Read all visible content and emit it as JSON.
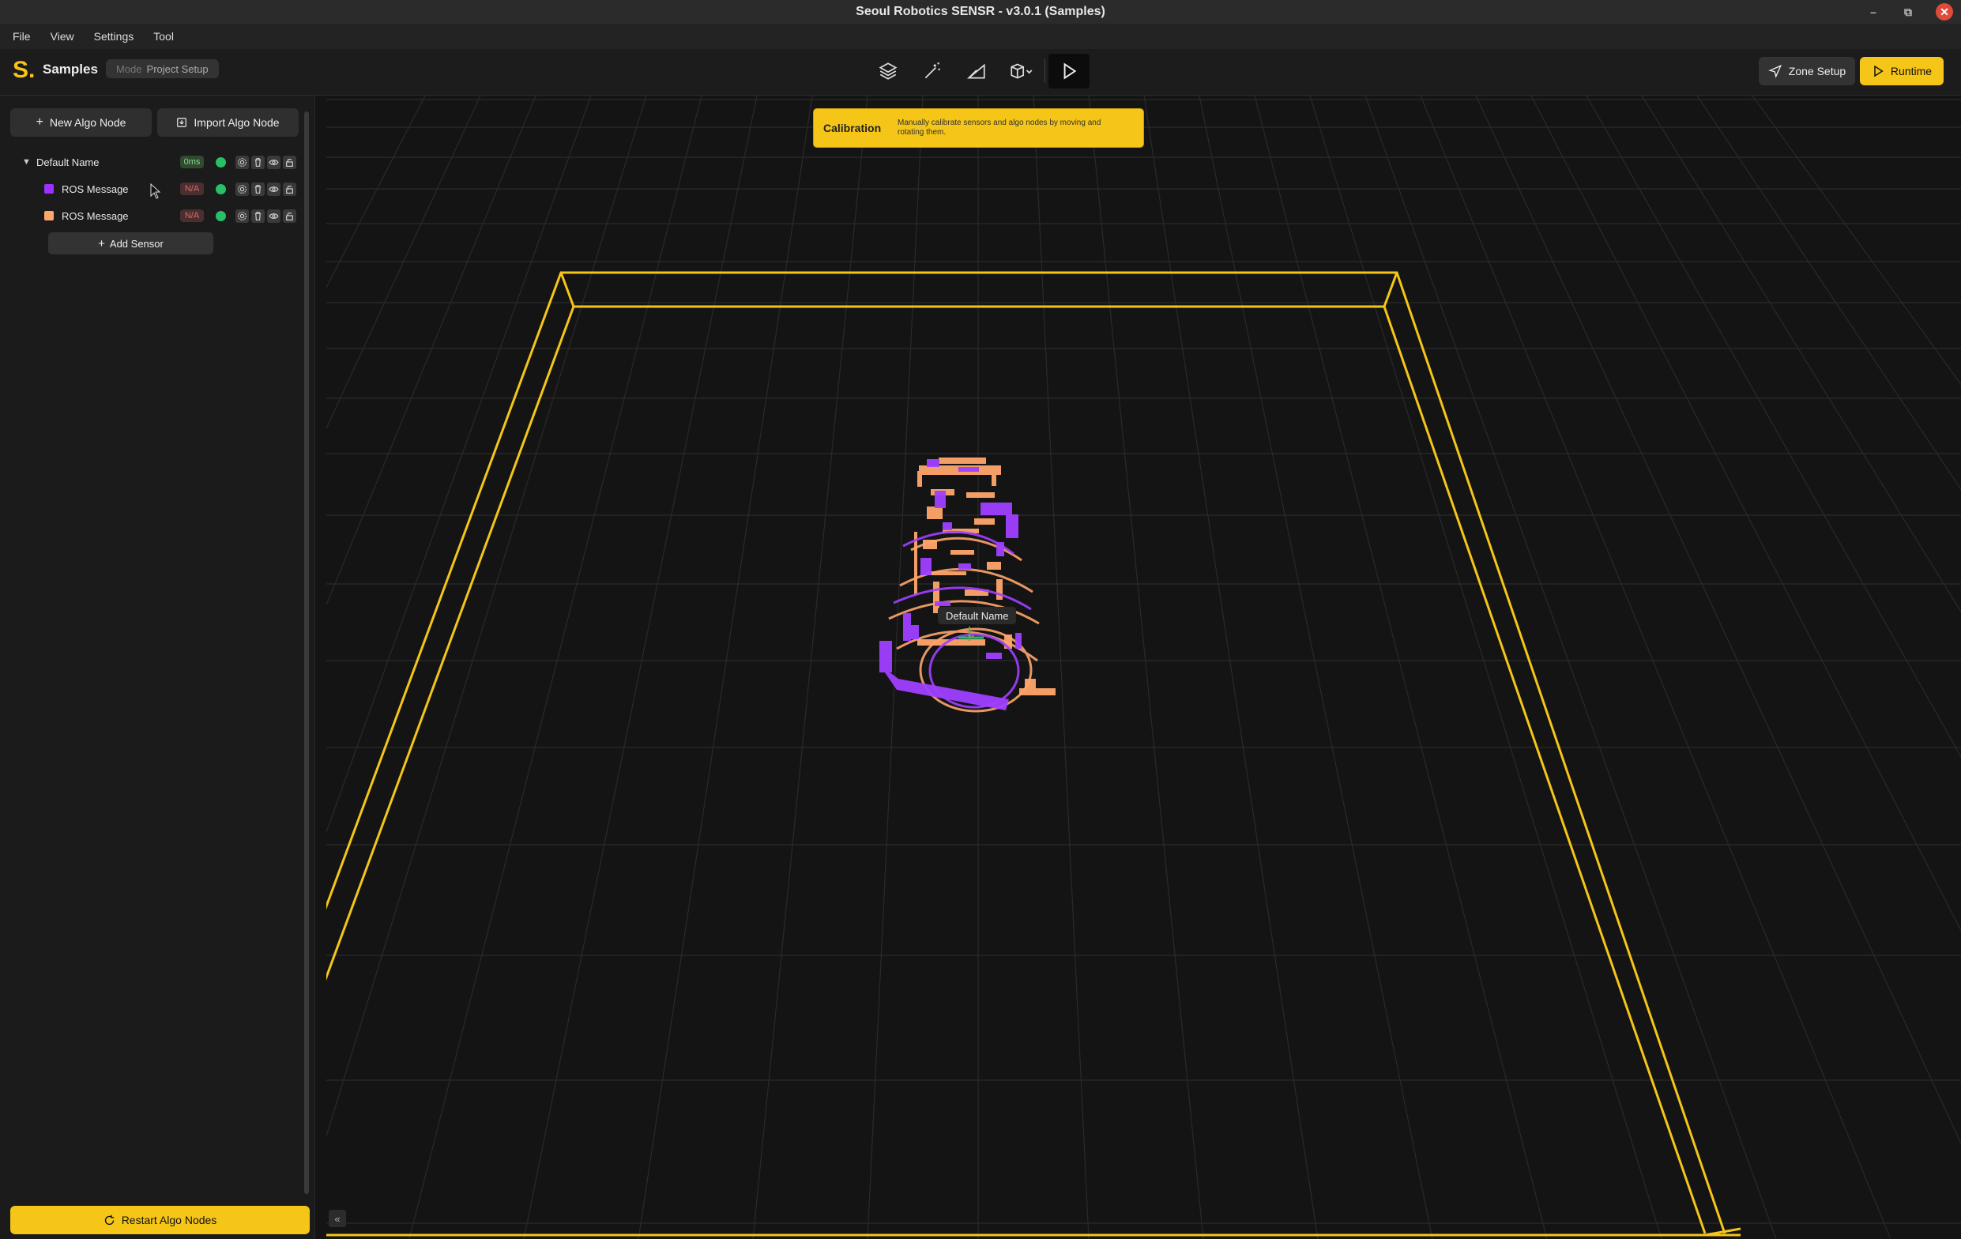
{
  "window": {
    "title": "Seoul Robotics SENSR - v3.0.1 (Samples)",
    "minimize_icon": "minimize-icon",
    "maximize_icon": "maximize-icon",
    "close_icon": "close-icon"
  },
  "menu": {
    "items": [
      "File",
      "View",
      "Settings",
      "Tool"
    ]
  },
  "appbar": {
    "logo": "S.",
    "project_name": "Samples",
    "mode_key": "Mode",
    "mode_value": "Project Setup",
    "tools": [
      "layers-icon",
      "magic-wand-icon",
      "ramp-icon",
      "cube-dropdown-icon",
      "play-icon"
    ],
    "zone_setup_label": "Zone Setup",
    "runtime_label": "Runtime"
  },
  "sidebar": {
    "new_algo_label": "New Algo Node",
    "import_algo_label": "Import Algo Node",
    "tree": [
      {
        "label": "Default Name",
        "latency": "0ms",
        "latency_state": "ok",
        "expanded": true
      },
      {
        "label": "ROS Message",
        "latency": "N/A",
        "latency_state": "na",
        "color": "#9b30ff"
      },
      {
        "label": "ROS Message",
        "latency": "N/A",
        "latency_state": "na",
        "color": "#ffa66b"
      }
    ],
    "add_sensor_label": "Add Sensor",
    "restart_label": "Restart Algo Nodes"
  },
  "viewport": {
    "banner_title": "Calibration",
    "banner_text": "Manually calibrate sensors and algo nodes by moving and rotating them.",
    "node_label": "Default Name",
    "zone_color": "#f5c518",
    "sensor_colors": [
      "#a040ff",
      "#ffa66b"
    ]
  }
}
